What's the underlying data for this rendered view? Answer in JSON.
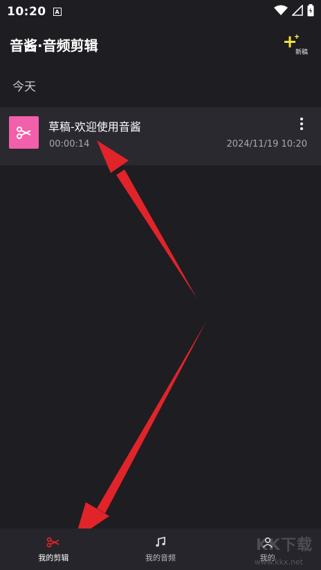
{
  "status_bar": {
    "time": "10:20",
    "app_badge": "A"
  },
  "header": {
    "title": "音酱·音频剪辑",
    "new_label": "新稿"
  },
  "section": {
    "label": "今天"
  },
  "drafts": [
    {
      "title": "草稿-欢迎使用音酱",
      "duration": "00:00:14",
      "date": "2024/11/19 10:20"
    }
  ],
  "bottom_nav": [
    {
      "label": "我的剪辑",
      "icon": "scissors-icon",
      "active": true
    },
    {
      "label": "我的音频",
      "icon": "music-note-icon",
      "active": false
    },
    {
      "label": "我的",
      "icon": "user-icon",
      "active": false
    }
  ],
  "watermark": {
    "text": "KK下载",
    "url": "www.kkx.net"
  },
  "colors": {
    "accent_pink": "#f25faa",
    "accent_red": "#e0242a",
    "new_plus_yellow": "#f4e23a",
    "background": "#1e1d22"
  }
}
